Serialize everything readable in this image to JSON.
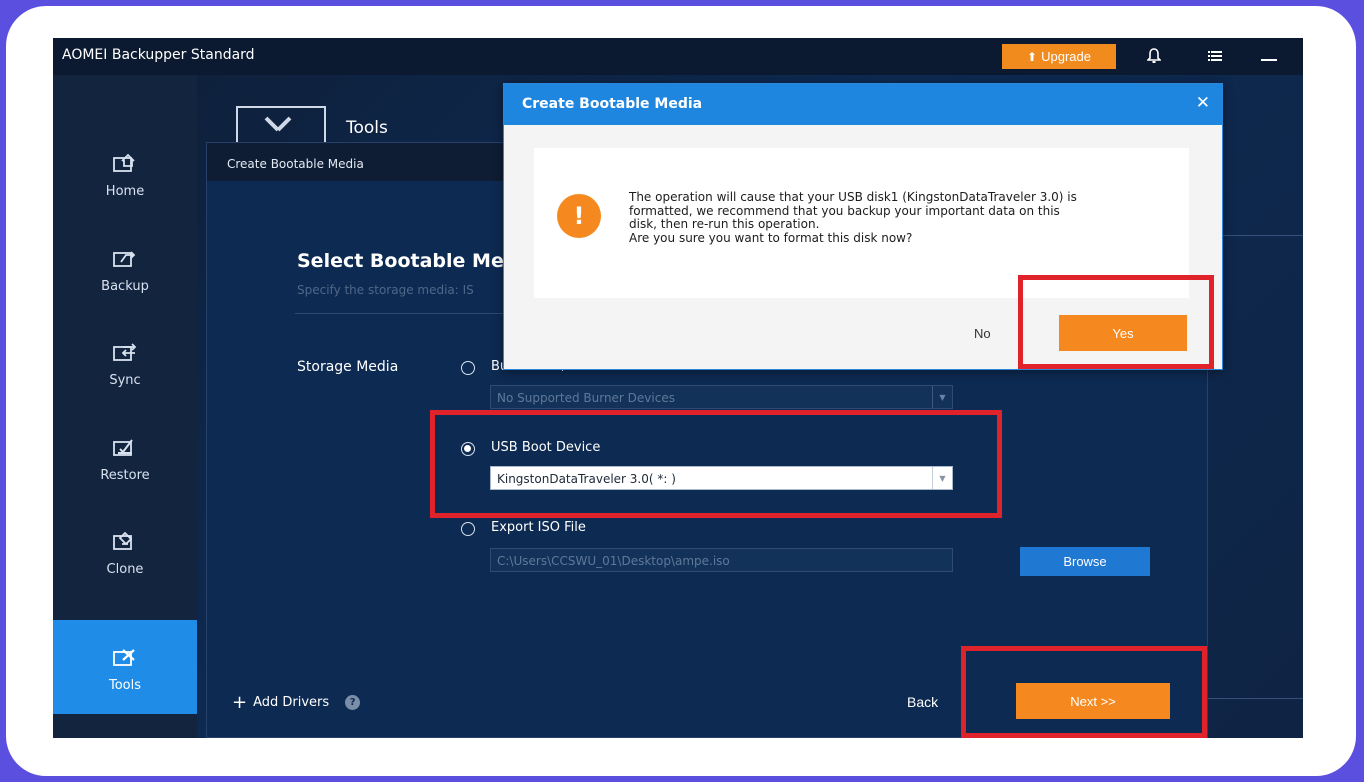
{
  "app": {
    "title": "AOMEI Backupper Standard",
    "upgrade_label": "Upgrade",
    "upgrade_color": "#f28b1e"
  },
  "sidebar": {
    "items": [
      {
        "label": "Home",
        "icon": "home-icon"
      },
      {
        "label": "Backup",
        "icon": "backup-icon"
      },
      {
        "label": "Sync",
        "icon": "sync-icon"
      },
      {
        "label": "Restore",
        "icon": "restore-icon"
      },
      {
        "label": "Clone",
        "icon": "clone-icon"
      },
      {
        "label": "Tools",
        "icon": "tools-icon",
        "active": true
      }
    ]
  },
  "tools_header": {
    "title": "Tools"
  },
  "wizard": {
    "title": "Create Bootable Media",
    "heading": "Select Bootable Me",
    "subtitle": "Specify the storage media: IS",
    "storage_label": "Storage Media",
    "options": [
      {
        "label": "Burn to CD/DVD",
        "selected": false,
        "select_value": "No Supported Burner Devices"
      },
      {
        "label": "USB Boot Device",
        "selected": true,
        "select_value": "KingstonDataTraveler 3.0( *: )"
      },
      {
        "label": "Export ISO File",
        "selected": false,
        "select_value": "C:\\Users\\CCSWU_01\\Desktop\\ampe.iso"
      }
    ],
    "browse_label": "Browse",
    "add_drivers_label": "Add Drivers",
    "back_label": "Back",
    "next_label": "Next >>"
  },
  "dialog": {
    "title": "Create Bootable Media",
    "message": "The operation will cause that your USB disk1 (KingstonDataTraveler 3.0) is\nformatted, we recommend that you backup your important data on this\ndisk, then re-run this operation.\nAre you sure you want to format this disk now?",
    "warning_glyph": "!",
    "no_label": "No",
    "yes_label": "Yes"
  },
  "colors": {
    "accent_orange": "#f5891f",
    "dialog_blue": "#1f86e0",
    "highlight_red": "#e0222b",
    "page_background": "#5b4fe0"
  }
}
